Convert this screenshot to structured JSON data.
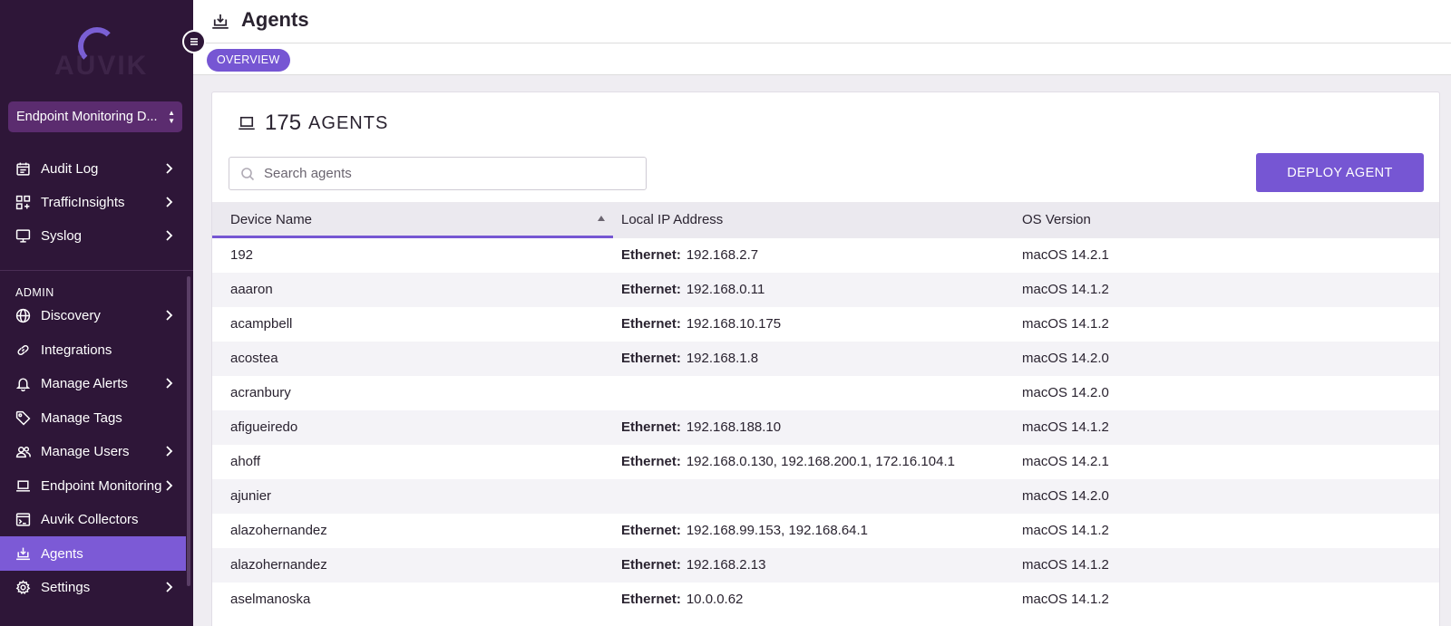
{
  "sidebar": {
    "logo_text": "AUVIK",
    "org_select": "Endpoint Monitoring D...",
    "items": [
      {
        "label": "Audit Log",
        "icon": "calendar-icon",
        "chevron": true
      },
      {
        "label": "TrafficInsights",
        "icon": "traffic-icon",
        "chevron": true
      },
      {
        "label": "Syslog",
        "icon": "monitor-icon",
        "chevron": true
      },
      {
        "label": "Discovery",
        "icon": "globe-icon",
        "chevron": true
      },
      {
        "label": "Integrations",
        "icon": "link-icon",
        "chevron": false
      },
      {
        "label": "Manage Alerts",
        "icon": "bell-icon",
        "chevron": true
      },
      {
        "label": "Manage Tags",
        "icon": "tag-icon",
        "chevron": false
      },
      {
        "label": "Manage Users",
        "icon": "users-icon",
        "chevron": true
      },
      {
        "label": "Endpoint Monitoring",
        "icon": "laptop-icon",
        "chevron": true
      },
      {
        "label": "Auvik Collectors",
        "icon": "terminal-icon",
        "chevron": false
      },
      {
        "label": "Agents",
        "icon": "agents-icon",
        "chevron": false,
        "active": true
      },
      {
        "label": "Settings",
        "icon": "gear-icon",
        "chevron": true
      }
    ],
    "section_admin": "ADMIN"
  },
  "header": {
    "title": "Agents"
  },
  "tabs": [
    {
      "label": "OVERVIEW",
      "active": true
    }
  ],
  "card": {
    "count": "175",
    "count_label": "AGENTS",
    "search_placeholder": "Search agents",
    "deploy_label": "DEPLOY AGENT"
  },
  "table": {
    "columns": [
      "Device Name",
      "Local IP Address",
      "OS Version"
    ],
    "sorted_column": "Device Name",
    "sort_direction": "ascending",
    "rows": [
      {
        "device": "192",
        "iface": "Ethernet:",
        "ip": "192.168.2.7",
        "os": "macOS 14.2.1"
      },
      {
        "device": "aaaron",
        "iface": "Ethernet:",
        "ip": "192.168.0.11",
        "os": "macOS 14.1.2"
      },
      {
        "device": "acampbell",
        "iface": "Ethernet:",
        "ip": "192.168.10.175",
        "os": "macOS 14.1.2"
      },
      {
        "device": "acostea",
        "iface": "Ethernet:",
        "ip": "192.168.1.8",
        "os": "macOS 14.2.0"
      },
      {
        "device": "acranbury",
        "iface": "",
        "ip": "",
        "os": "macOS 14.2.0"
      },
      {
        "device": "afigueiredo",
        "iface": "Ethernet:",
        "ip": "192.168.188.10",
        "os": "macOS 14.1.2"
      },
      {
        "device": "ahoff",
        "iface": "Ethernet:",
        "ip": "192.168.0.130, 192.168.200.1, 172.16.104.1",
        "os": "macOS 14.2.1"
      },
      {
        "device": "ajunier",
        "iface": "",
        "ip": "",
        "os": "macOS 14.2.0"
      },
      {
        "device": "alazohernandez",
        "iface": "Ethernet:",
        "ip": "192.168.99.153, 192.168.64.1",
        "os": "macOS 14.1.2"
      },
      {
        "device": "alazohernandez",
        "iface": "Ethernet:",
        "ip": "192.168.2.13",
        "os": "macOS 14.1.2"
      },
      {
        "device": "aselmanoska",
        "iface": "Ethernet:",
        "ip": "10.0.0.62",
        "os": "macOS 14.1.2"
      }
    ]
  },
  "colors": {
    "sidebar_bg": "#2e1638",
    "accent": "#7656d3",
    "active_nav": "#7c5ad6"
  }
}
